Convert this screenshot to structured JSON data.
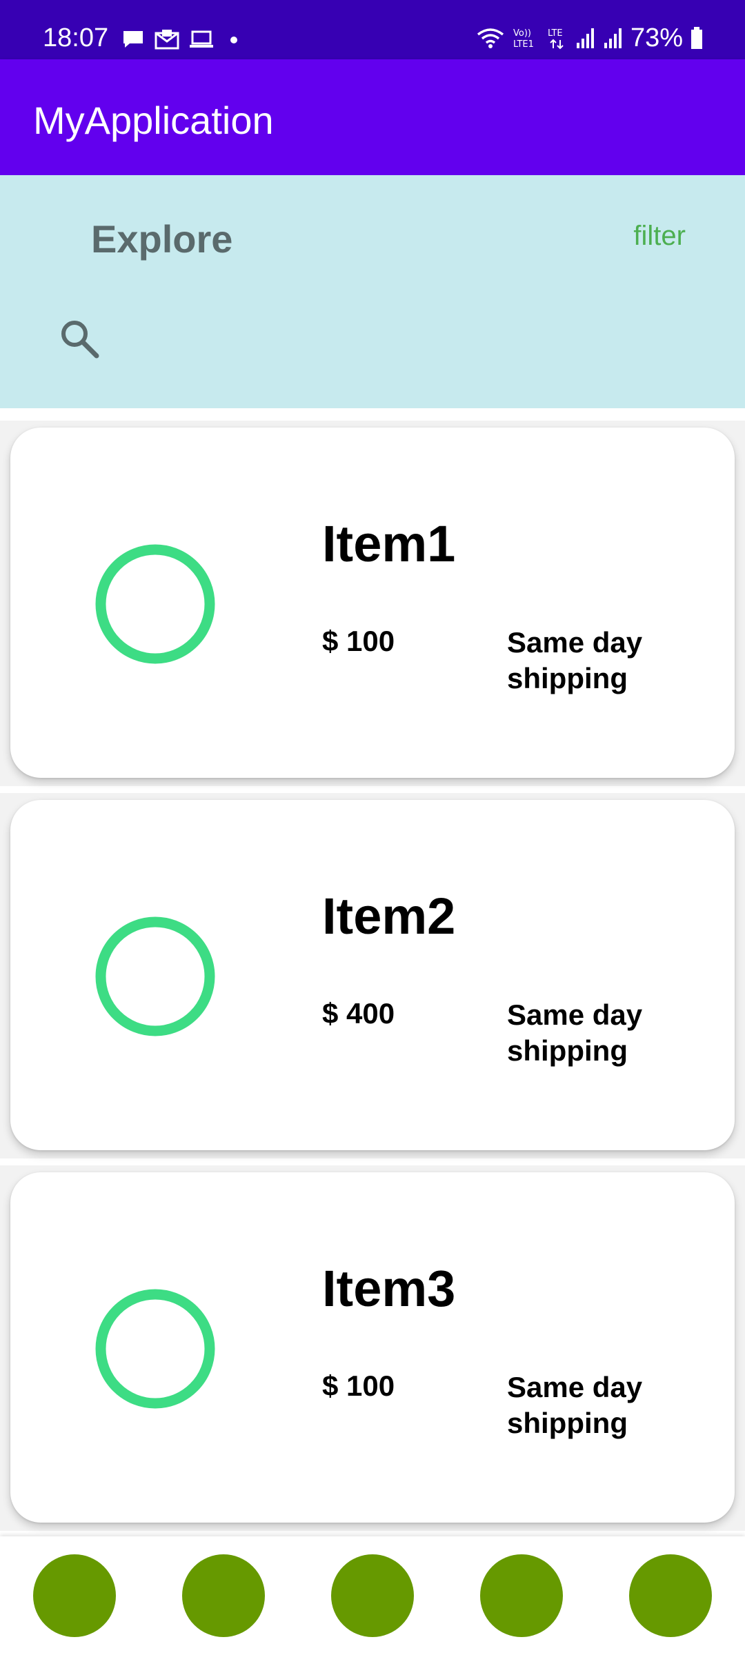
{
  "status_bar": {
    "time": "18:07",
    "battery": "73%",
    "icons": [
      "chat-icon",
      "mail-icon",
      "laptop-icon",
      "dot-icon",
      "wifi-icon",
      "volte-icon",
      "lte-icon",
      "signal-icon",
      "signal-icon",
      "battery-icon"
    ]
  },
  "app_bar": {
    "title": "MyApplication"
  },
  "explore": {
    "title": "Explore",
    "filter_label": "filter",
    "search_icon": "search-icon"
  },
  "items": [
    {
      "name": "Item1",
      "price": "$ 100",
      "shipping": "Same day shipping"
    },
    {
      "name": "Item2",
      "price": "$ 400",
      "shipping": "Same day shipping"
    },
    {
      "name": "Item3",
      "price": "$ 100",
      "shipping": "Same day shipping"
    }
  ],
  "bottom_nav": {
    "count": 5
  },
  "colors": {
    "status_bar": "#3700B3",
    "app_bar": "#6200EE",
    "explore_bg": "#C7EAEE",
    "filter_text": "#4CAF50",
    "ring": "#3DDC84",
    "nav_dot": "#669900"
  }
}
